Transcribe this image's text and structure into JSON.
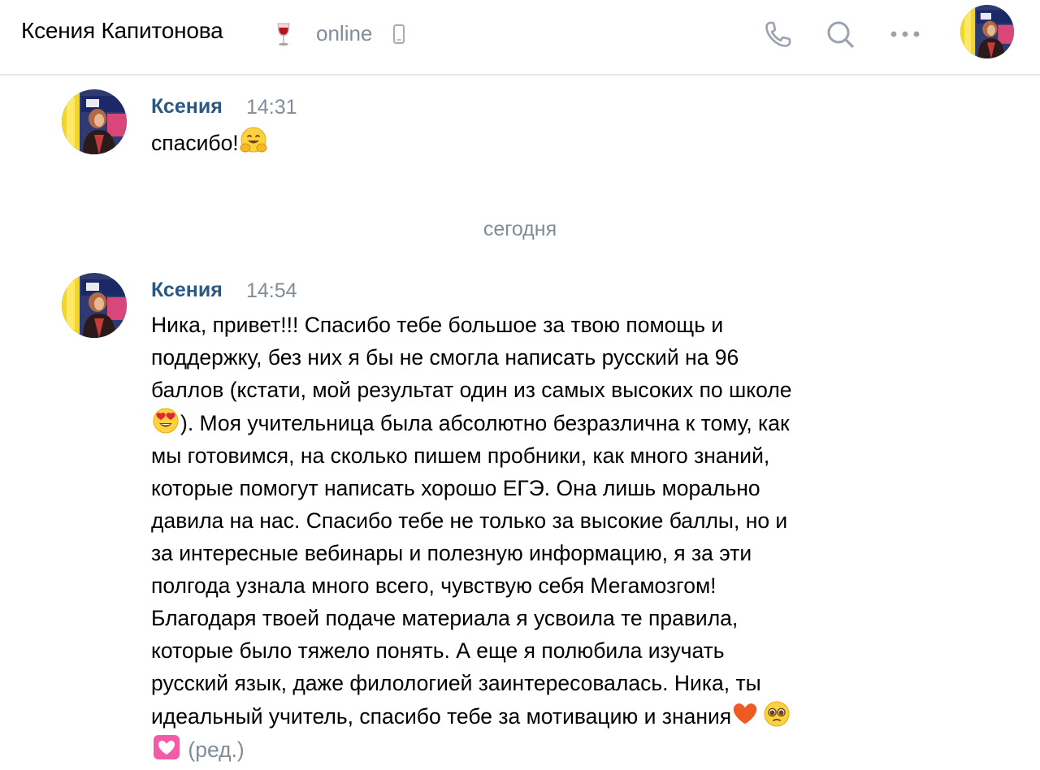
{
  "header": {
    "contact_name": "Ксения Капитонова",
    "status": "online",
    "icons": [
      "wine-glass-icon",
      "mobile-icon",
      "phone-icon",
      "search-icon",
      "more-icon"
    ]
  },
  "colors": {
    "link": "#2a5885",
    "muted": "#818c99",
    "divider": "#e7e8ec"
  },
  "messages": [
    {
      "author": "Ксения",
      "time": "14:31",
      "text": "спасибо!",
      "emoji": "hugging-face-emoji"
    },
    {
      "author": "Ксения",
      "time": "14:54",
      "lines": [
        "Ника, привет!!! Спасибо тебе большое за твою помощь и",
        "поддержку, без них я бы не смогла написать русский на 96",
        "баллов (кстати, мой результат один из самых высоких по школе",
        "). Моя учительница была абсолютно безразлична к тому, как",
        "мы готовимся, на сколько пишем пробники, как много знаний,",
        "которые помогут написать хорошо ЕГЭ. Она лишь морально",
        "давила на нас. Спасибо тебе не только за высокие баллы, но и",
        "за интересные вебинары и полезную информацию, я за эти",
        "полгода узнала много всего, чувствую себя Мегамозгом!",
        "Благодаря твоей подаче материала я усвоила те правила,",
        "которые было тяжело понять. А еще я полюбила изучать",
        "русский язык, даже филологией заинтересовалась. Ника, ты",
        "идеальный учитель, спасибо тебе за мотивацию и знания"
      ],
      "edited_label": "(ред.)"
    }
  ],
  "date_separator": "сегодня"
}
